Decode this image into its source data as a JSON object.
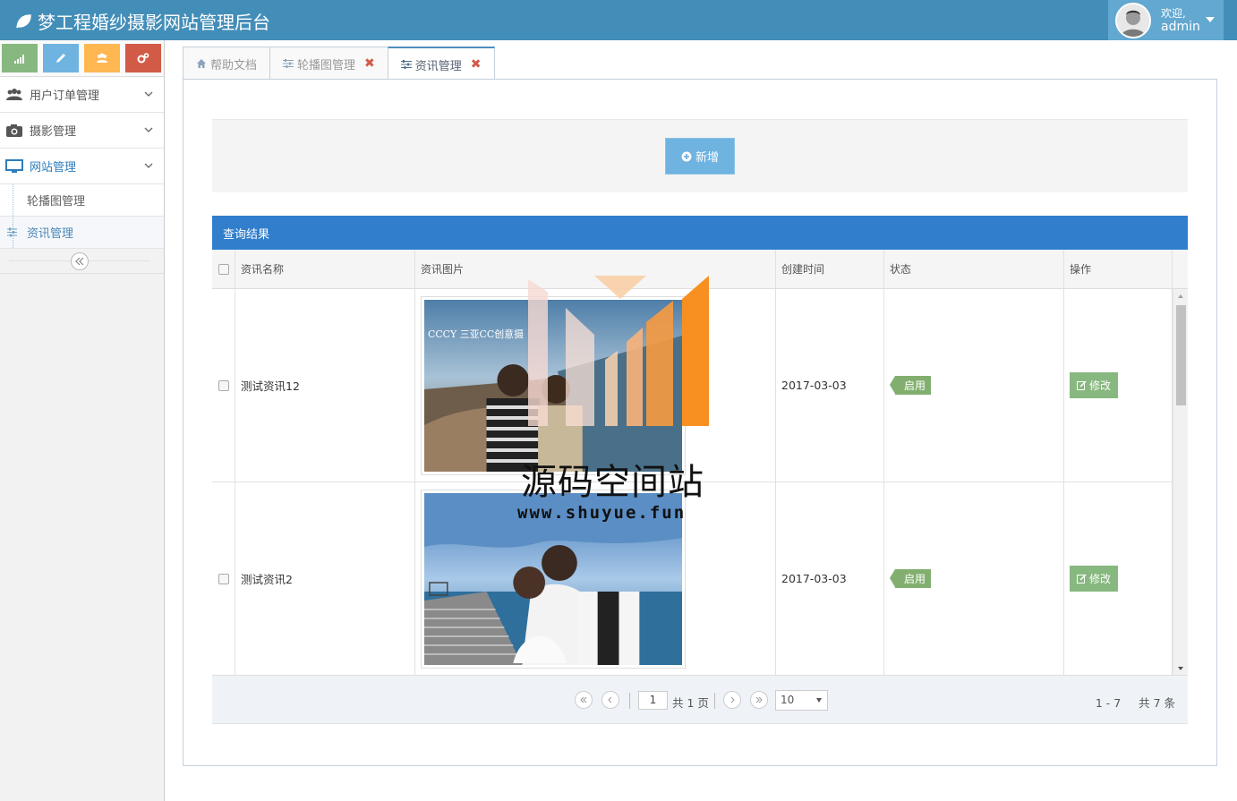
{
  "app": {
    "title": "梦工程婚纱摄影网站管理后台"
  },
  "user": {
    "welcome": "欢迎,",
    "name": "admin"
  },
  "sidebar": {
    "shortcuts": [
      {
        "icon": "signal-icon",
        "color": "#87b87f"
      },
      {
        "icon": "pencil-icon",
        "color": "#6fb3e0"
      },
      {
        "icon": "users-icon",
        "color": "#ffb752"
      },
      {
        "icon": "cogs-icon",
        "color": "#d15b47"
      }
    ],
    "menu": [
      {
        "label": "用户订单管理",
        "icon": "users-icon"
      },
      {
        "label": "摄影管理",
        "icon": "camera-icon"
      },
      {
        "label": "网站管理",
        "icon": "desktop-icon"
      }
    ],
    "submenu": [
      {
        "label": "轮播图管理"
      },
      {
        "label": "资讯管理"
      }
    ]
  },
  "tabs": [
    {
      "label": "帮助文档",
      "icon": "home-icon",
      "closable": false
    },
    {
      "label": "轮播图管理",
      "icon": "sliders-icon",
      "closable": true
    },
    {
      "label": "资讯管理",
      "icon": "sliders-icon",
      "closable": true
    }
  ],
  "tab_close_glyph": "✖",
  "toolbar": {
    "add_label": "新增"
  },
  "grid": {
    "caption": "查询结果",
    "columns": [
      "资讯名称",
      "资讯图片",
      "创建时间",
      "状态",
      "操作"
    ],
    "rows": [
      {
        "name": "测试资讯12",
        "image": "couple-beach-photo",
        "created": "2017-03-03",
        "status": "启用",
        "action": "修改"
      },
      {
        "name": "测试资讯2",
        "image": "wedding-seaside-photo",
        "created": "2017-03-03",
        "status": "启用",
        "action": "修改"
      }
    ],
    "photo_text": "CCCY 三亚CC创意摄"
  },
  "pager": {
    "current_page": "1",
    "total_pages_text": "共 1 页",
    "page_size": "10",
    "record_range": "1 - 7",
    "record_total": "共 7 条"
  },
  "watermark": {
    "title": "源码空间站",
    "url": "www.shuyue.fun"
  },
  "colors": {
    "navbar": "#438eb9",
    "caption": "#307ecc",
    "status_label": "#82af6f",
    "edit_button": "#87b87f",
    "add_button": "#6fb3e0"
  }
}
